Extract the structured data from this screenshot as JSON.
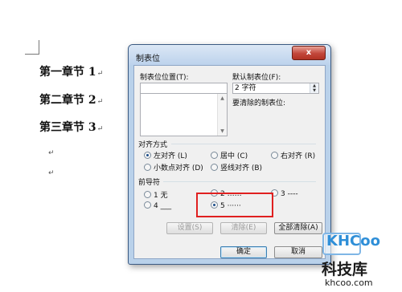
{
  "document": {
    "headings": [
      {
        "text": "第一章节 1",
        "mark": "↵"
      },
      {
        "text": "第二章节 2",
        "mark": "↵"
      },
      {
        "text": "第三章节 3",
        "mark": "↵"
      }
    ],
    "empty_paragraph_mark": "↵"
  },
  "dialog": {
    "title": "制表位",
    "close_label": "x",
    "tab_stop_position_label": "制表位位置(T):",
    "tab_stop_position_value": "",
    "default_tab_label": "默认制表位(F):",
    "default_tab_value": "2 字符",
    "to_clear_label": "要清除的制表位:",
    "alignment": {
      "label": "对齐方式",
      "options": [
        {
          "label": "左对齐 (L)",
          "selected": true
        },
        {
          "label": "居中 (C)",
          "selected": false
        },
        {
          "label": "右对齐 (R)",
          "selected": false
        },
        {
          "label": "小数点对齐 (D)",
          "selected": false
        },
        {
          "label": "竖线对齐 (B)",
          "selected": false
        }
      ]
    },
    "leader": {
      "label": "前导符",
      "options": [
        {
          "label": "1 无",
          "selected": false
        },
        {
          "label": "2 ……",
          "selected": false
        },
        {
          "label": "3 ----",
          "selected": false
        },
        {
          "label": "4 ___",
          "selected": false
        },
        {
          "label": "5 ······",
          "selected": true
        }
      ]
    },
    "buttons": {
      "set": "设置(S)",
      "clear": "清除(E)",
      "clear_all": "全部清除(A)",
      "ok": "确定",
      "cancel": "取消"
    }
  },
  "watermark": {
    "brand": "KHCoo",
    "name": "科技库",
    "url": "khcoo.com"
  },
  "colors": {
    "dialog_frame": "#b9d1ea",
    "close_button": "#c2463a",
    "highlight": "#e02020",
    "watermark_blue": "#2f8fd8"
  }
}
